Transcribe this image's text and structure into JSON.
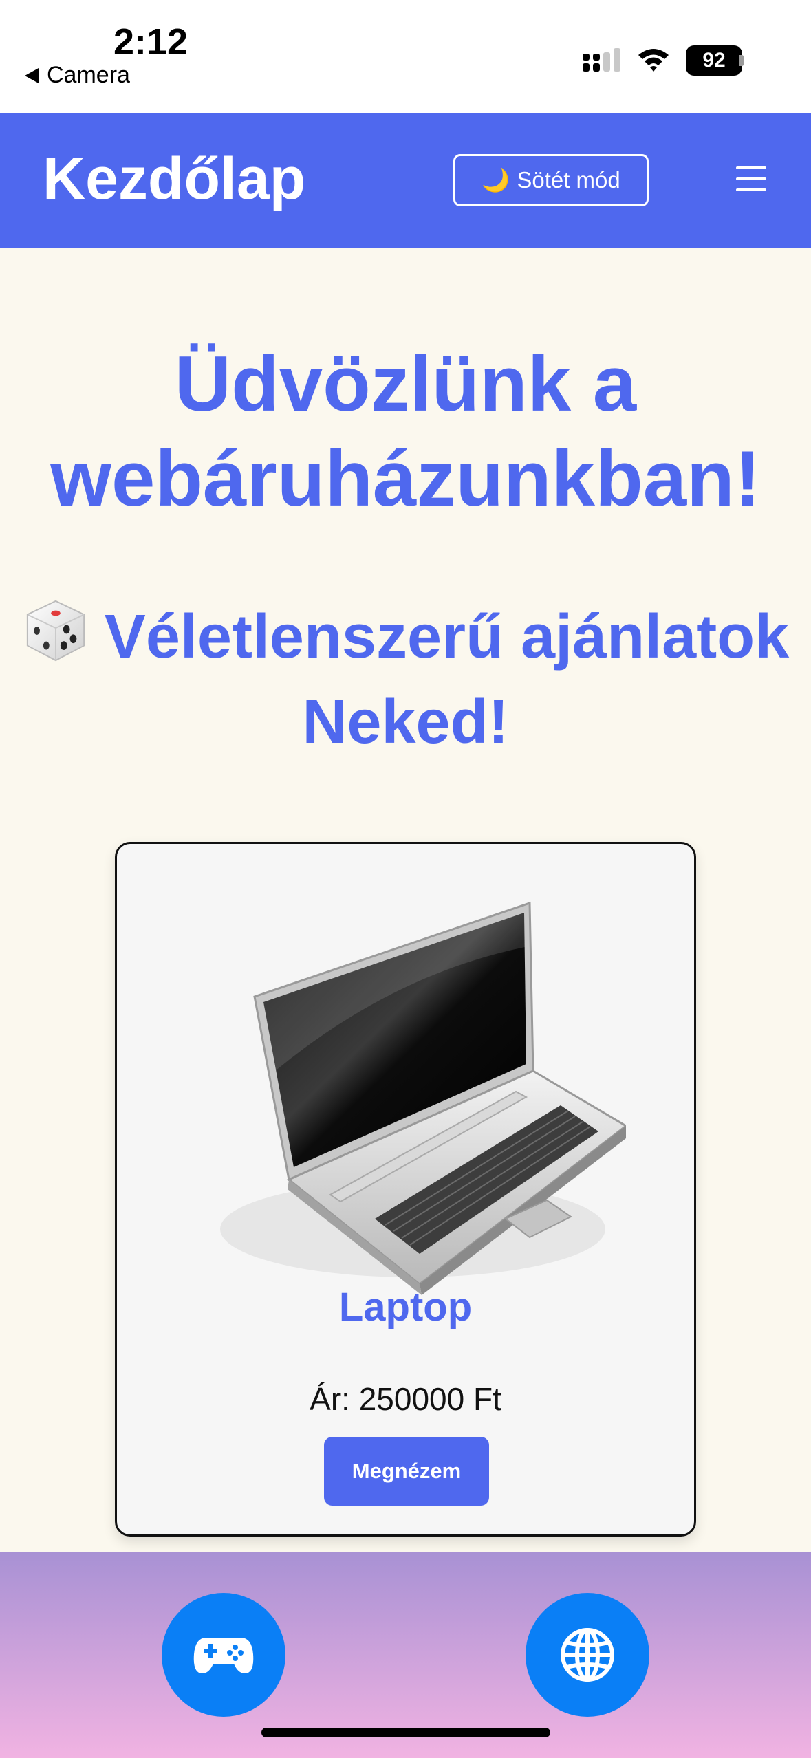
{
  "status_bar": {
    "time": "2:12",
    "back_label": "Camera",
    "battery": "92"
  },
  "header": {
    "title": "Kezdőlap",
    "dark_mode_icon": "🌙",
    "dark_mode_label": "Sötét mód"
  },
  "main": {
    "welcome_title": "Üdvözlünk a webáruházunkban!",
    "offers_title": "Véletlenszerű ajánlatok Neked!"
  },
  "product": {
    "name": "Laptop",
    "price": "Ár: 250000 Ft",
    "button_label": "Megnézem"
  },
  "bottom_nav": {
    "icons": [
      "gamepad-icon",
      "globe-icon"
    ]
  },
  "colors": {
    "accent": "#4f68ee",
    "background": "#fbf8ee",
    "fab": "#0a7ff6"
  }
}
